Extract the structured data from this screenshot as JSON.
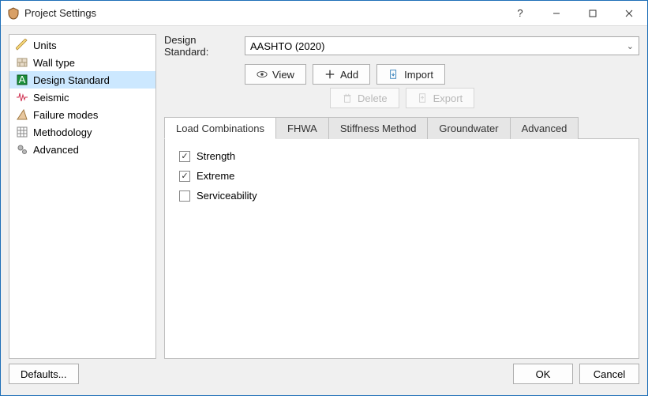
{
  "window": {
    "title": "Project Settings",
    "help": "?"
  },
  "sidebar": {
    "items": [
      {
        "label": "Units"
      },
      {
        "label": "Wall type"
      },
      {
        "label": "Design Standard"
      },
      {
        "label": "Seismic"
      },
      {
        "label": "Failure modes"
      },
      {
        "label": "Methodology"
      },
      {
        "label": "Advanced"
      }
    ]
  },
  "form": {
    "design_standard_label": "Design Standard:",
    "design_standard_value": "AASHTO (2020)"
  },
  "toolbar": {
    "view": "View",
    "add": "Add",
    "import": "Import",
    "delete": "Delete",
    "export": "Export"
  },
  "tabs": {
    "items": [
      {
        "label": "Load Combinations"
      },
      {
        "label": "FHWA"
      },
      {
        "label": "Stiffness Method"
      },
      {
        "label": "Groundwater"
      },
      {
        "label": "Advanced"
      }
    ]
  },
  "load_combinations": {
    "strength": {
      "label": "Strength",
      "checked": true
    },
    "extreme": {
      "label": "Extreme",
      "checked": true
    },
    "serviceability": {
      "label": "Serviceability",
      "checked": false
    }
  },
  "footer": {
    "defaults": "Defaults...",
    "ok": "OK",
    "cancel": "Cancel"
  }
}
